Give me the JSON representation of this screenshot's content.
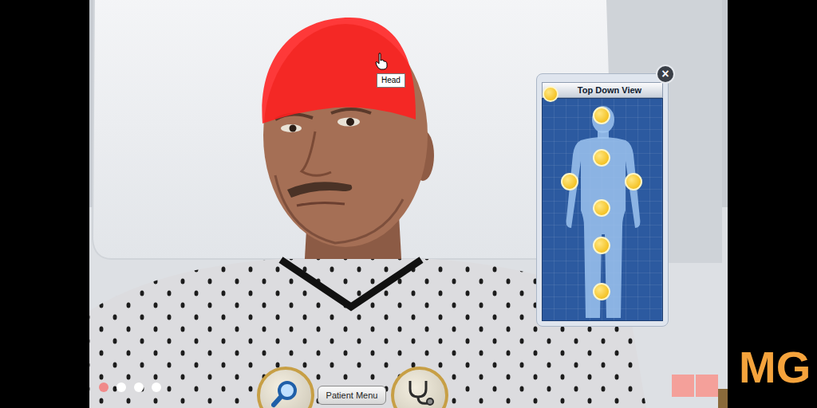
{
  "patient": {
    "head_highlighted": true,
    "tooltip": "Head"
  },
  "top_down_view": {
    "title": "Top Down View",
    "close": "×"
  },
  "patient_menu": {
    "label": "Patient Menu"
  },
  "pager": [
    {
      "selected": true
    },
    {
      "selected": false
    },
    {
      "selected": false
    },
    {
      "selected": false
    }
  ],
  "watermark": "MG"
}
